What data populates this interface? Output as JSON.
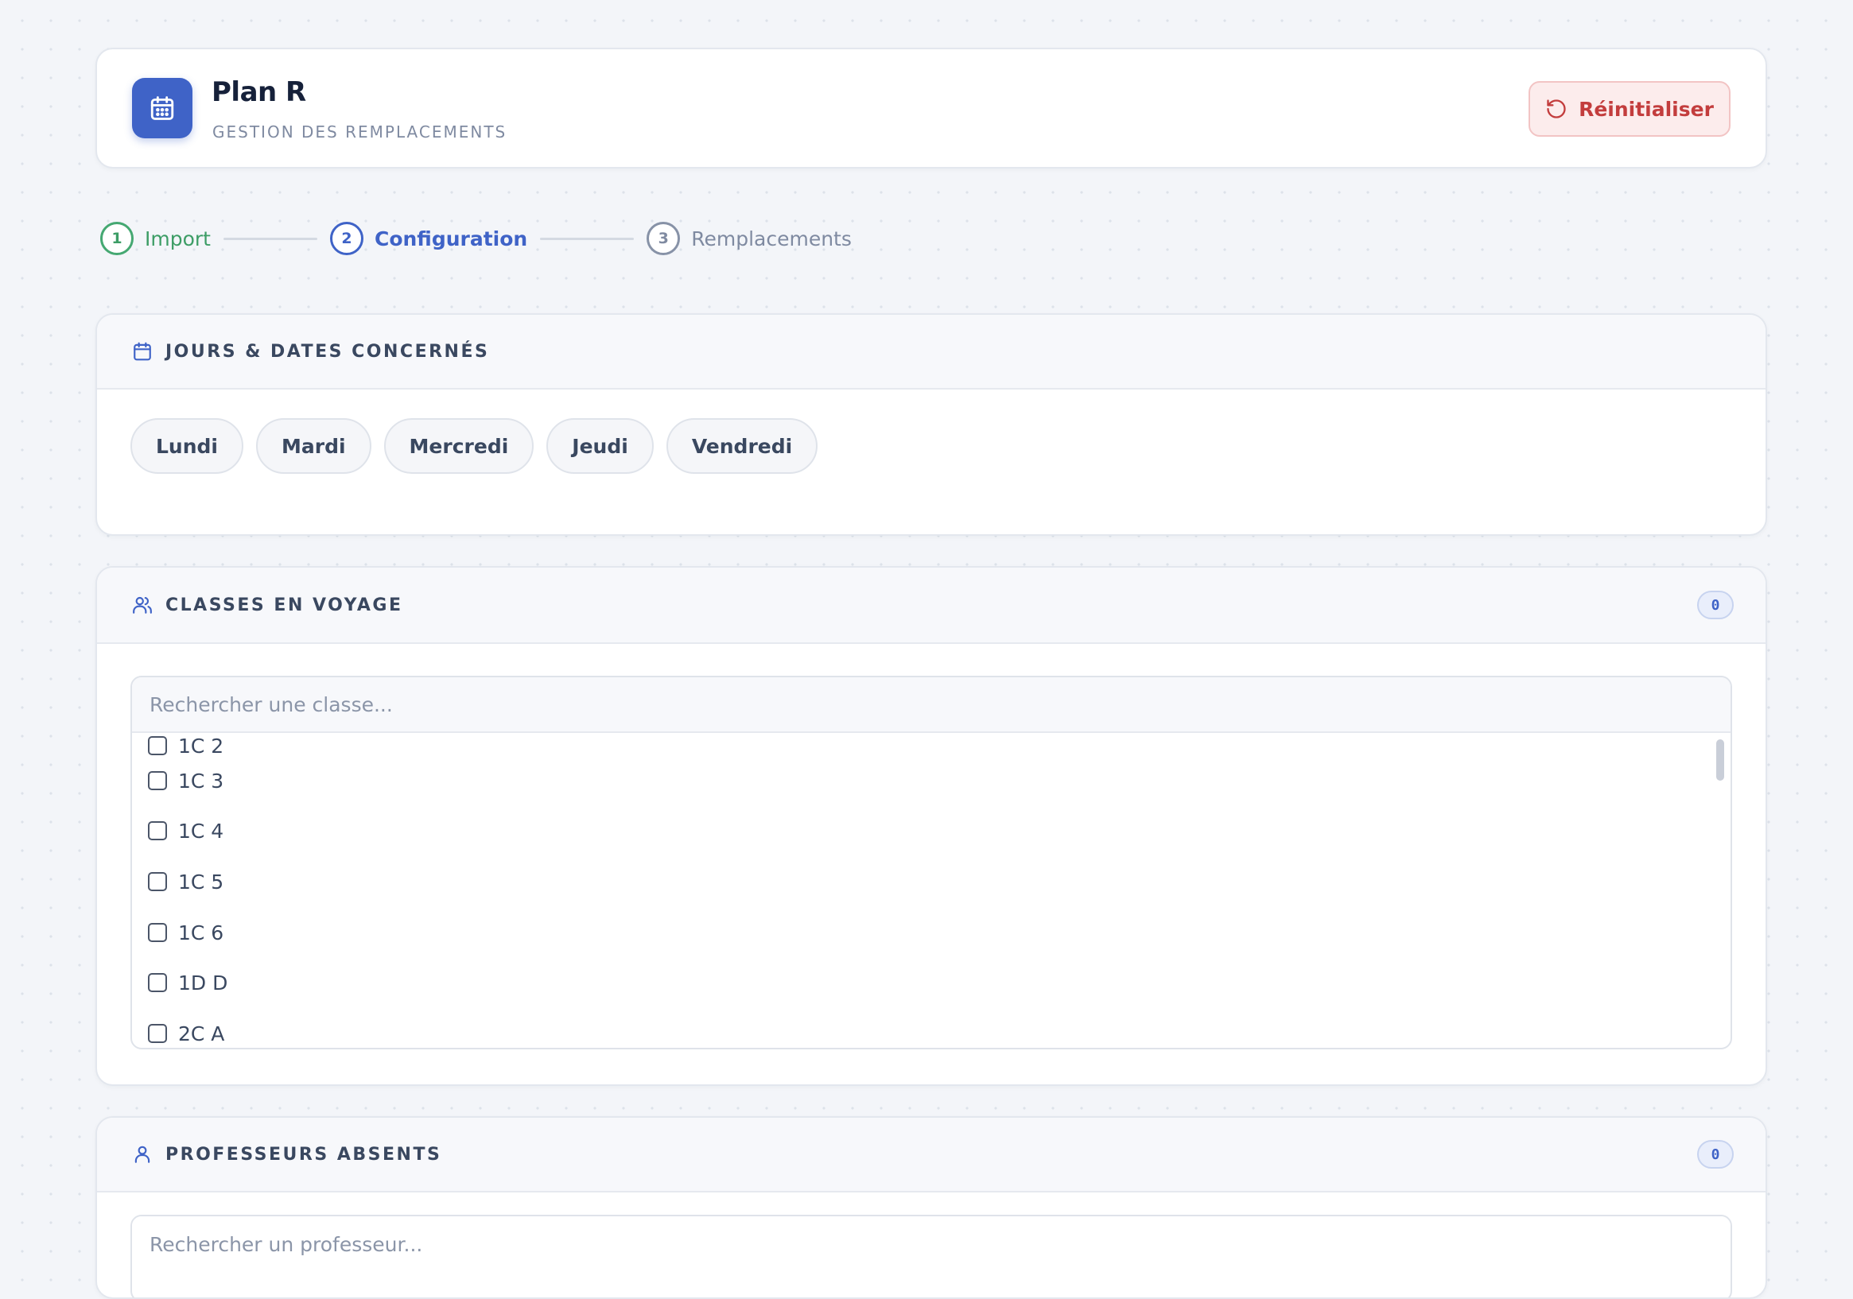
{
  "header": {
    "app_title": "Plan R",
    "app_subtitle": "GESTION DES REMPLACEMENTS",
    "reset_label": "Réinitialiser"
  },
  "stepper": {
    "steps": [
      {
        "number": "1",
        "label": "Import",
        "state": "done"
      },
      {
        "number": "2",
        "label": "Configuration",
        "state": "active"
      },
      {
        "number": "3",
        "label": "Remplacements",
        "state": "todo"
      }
    ]
  },
  "days_section": {
    "title": "JOURS & DATES CONCERNÉS",
    "days": [
      "Lundi",
      "Mardi",
      "Mercredi",
      "Jeudi",
      "Vendredi"
    ]
  },
  "classes_section": {
    "title": "CLASSES EN VOYAGE",
    "count": "0",
    "search_placeholder": "Rechercher une classe...",
    "items": [
      {
        "label": "1C 2",
        "checked": false
      },
      {
        "label": "1C 3",
        "checked": false
      },
      {
        "label": "1C 4",
        "checked": false
      },
      {
        "label": "1C 5",
        "checked": false
      },
      {
        "label": "1C 6",
        "checked": false
      },
      {
        "label": "1D D",
        "checked": false
      },
      {
        "label": "2C A",
        "checked": false
      }
    ]
  },
  "profs_section": {
    "title": "PROFESSEURS ABSENTS",
    "count": "0",
    "search_placeholder": "Rechercher un professeur..."
  },
  "colors": {
    "primary": "#3f63c7",
    "success": "#3d9d66",
    "danger": "#c33d3d",
    "background": "#f3f5f9"
  }
}
